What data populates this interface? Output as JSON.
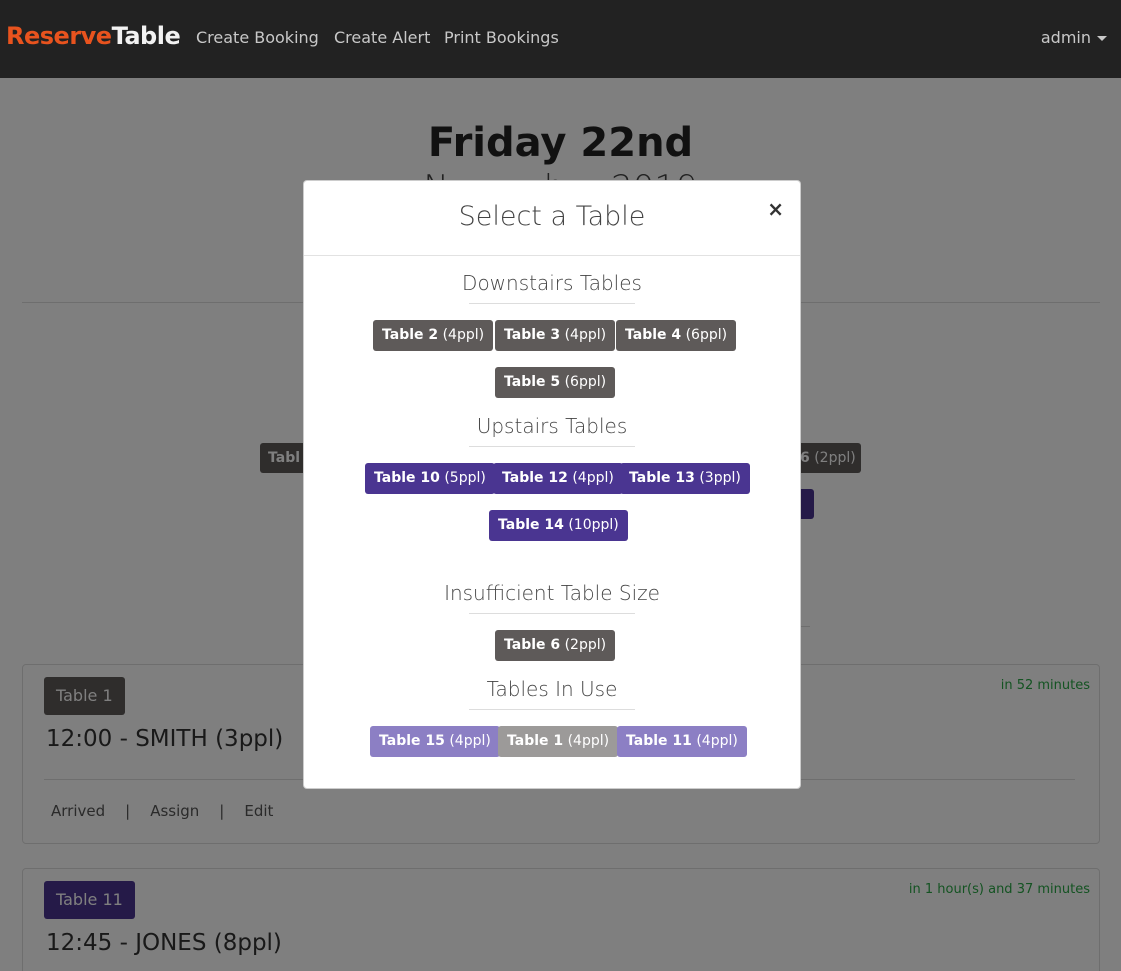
{
  "navbar": {
    "brand_part1": "Reserve",
    "brand_part2": "Table",
    "links": [
      "Create Booking",
      "Create Alert",
      "Print Bookings"
    ],
    "user": "admin"
  },
  "page": {
    "day_title": "Friday 22nd",
    "month_title": "November 2019"
  },
  "background_chips": {
    "left_partial": "Tabl",
    "right_partial_bold": "6",
    "right_partial_cap": "(2ppl)",
    "right_purple_partial": ")"
  },
  "bookings": [
    {
      "table": "Table 1",
      "time_name": "12:00 - SMITH (3ppl)",
      "eta": "in 52 minutes",
      "actions": [
        "Arrived",
        "|",
        "Assign",
        "|",
        "Edit"
      ]
    },
    {
      "table": "Table 11",
      "time_name": "12:45 - JONES (8ppl)",
      "eta": "in 1 hour(s) and 37 minutes"
    }
  ],
  "modal": {
    "title": "Select a Table",
    "close": "×",
    "sections": [
      {
        "title": "Downstairs Tables",
        "tables": [
          {
            "name": "Table 2",
            "cap": "(4ppl)"
          },
          {
            "name": "Table 3",
            "cap": "(4ppl)"
          },
          {
            "name": "Table 4",
            "cap": "(6ppl)"
          },
          {
            "name": "Table 5",
            "cap": "(6ppl)"
          }
        ]
      },
      {
        "title": "Upstairs Tables",
        "tables": [
          {
            "name": "Table 10",
            "cap": "(5ppl)"
          },
          {
            "name": "Table 12",
            "cap": "(4ppl)"
          },
          {
            "name": "Table 13",
            "cap": "(3ppl)"
          },
          {
            "name": "Table 14",
            "cap": "(10ppl)"
          }
        ]
      },
      {
        "title": "Insufficient Table Size",
        "tables": [
          {
            "name": "Table 6",
            "cap": "(2ppl)"
          }
        ]
      },
      {
        "title": "Tables In Use",
        "tables": [
          {
            "name": "Table 15",
            "cap": "(4ppl)"
          },
          {
            "name": "Table 1",
            "cap": "(4ppl)"
          },
          {
            "name": "Table 11",
            "cap": "(4ppl)"
          }
        ]
      }
    ]
  },
  "colors": {
    "brand_accent": "#e8531e",
    "downstairs_button": "#5e5a59",
    "upstairs_button": "#4a3591",
    "in_use_purple": "#8c7fc4",
    "in_use_gray": "#9c9a99",
    "eta_green": "#28a745"
  }
}
